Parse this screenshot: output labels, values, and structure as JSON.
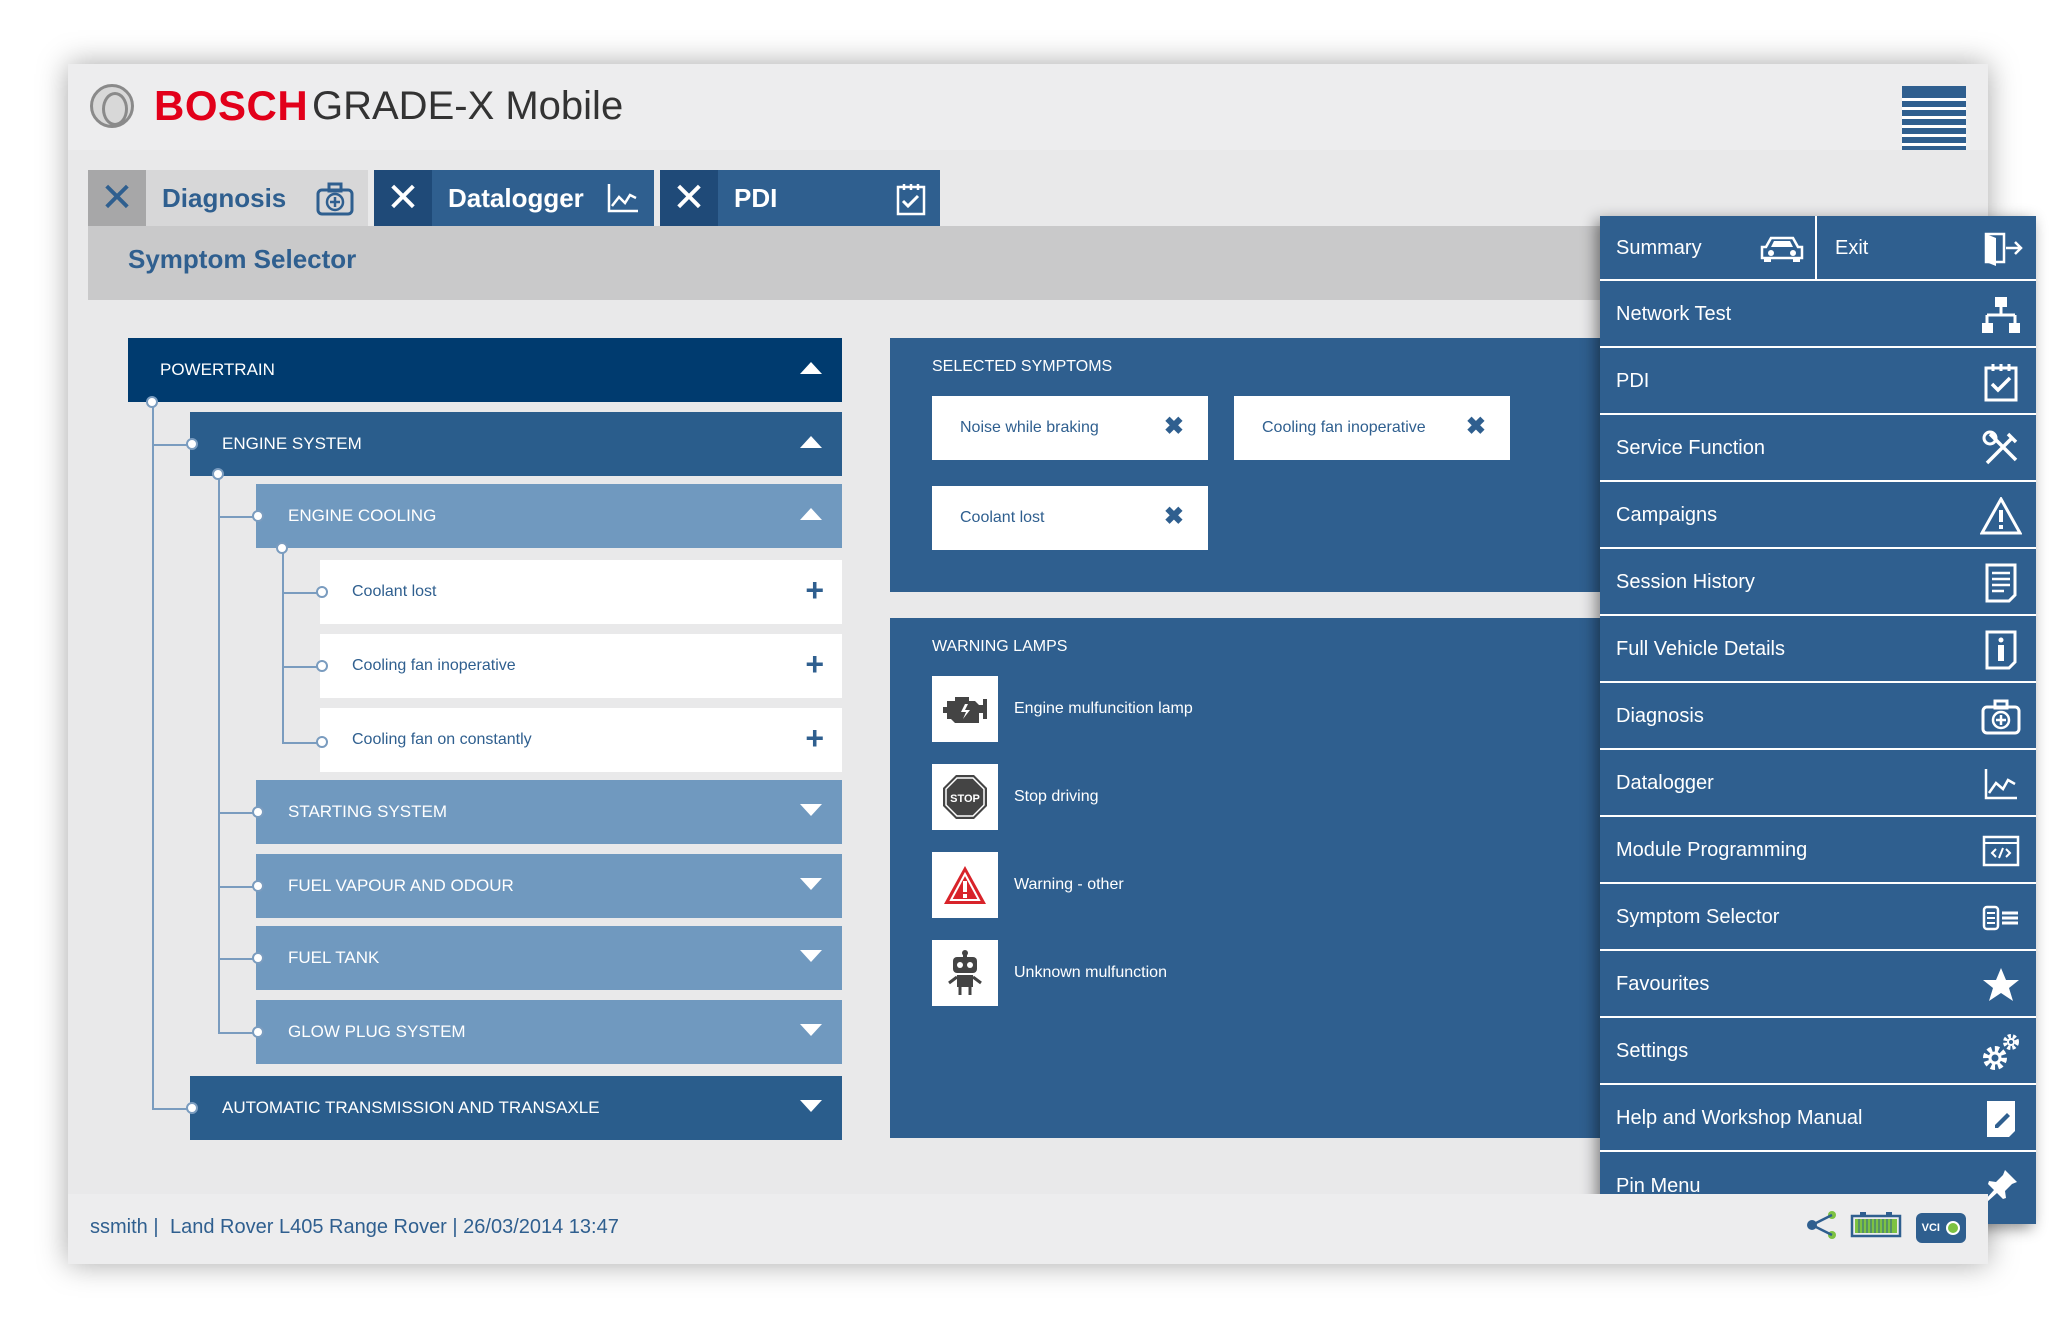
{
  "header": {
    "brand": "BOSCH",
    "app_title": "GRADE-X Mobile"
  },
  "tabs": [
    {
      "label": "Diagnosis",
      "icon": "medical-kit-icon"
    },
    {
      "label": "Datalogger",
      "icon": "line-chart-icon"
    },
    {
      "label": "PDI",
      "icon": "clipboard-check-icon"
    }
  ],
  "page": {
    "title": "Symptom Selector"
  },
  "tree": {
    "powertrain": "POWERTRAIN",
    "engine_system": "ENGINE SYSTEM",
    "engine_cooling": "ENGINE COOLING",
    "leaves": [
      "Coolant lost",
      "Cooling fan inoperative",
      "Cooling fan on constantly"
    ],
    "starting_system": "STARTING SYSTEM",
    "fuel_vapour": "FUEL VAPOUR AND ODOUR",
    "fuel_tank": "FUEL TANK",
    "glow_plug": "GLOW PLUG SYSTEM",
    "auto_trans": "AUTOMATIC TRANSMISSION AND TRANSAXLE"
  },
  "selected": {
    "heading": "SELECTED SYMPTOMS",
    "items": [
      "Noise while braking",
      "Cooling fan inoperative",
      "Coolant lost"
    ]
  },
  "lamps": {
    "heading": "WARNING LAMPS",
    "items": [
      {
        "label": "Engine mulfuncition lamp",
        "icon": "engine-icon"
      },
      {
        "label": "Stop driving",
        "icon": "stop-sign-icon"
      },
      {
        "label": "Warning - other",
        "icon": "warning-triangle-icon"
      },
      {
        "label": "Unknown mulfunction",
        "icon": "robot-icon"
      }
    ]
  },
  "menu": {
    "summary": "Summary",
    "exit": "Exit",
    "items": [
      {
        "label": "Network Test",
        "icon": "network-icon"
      },
      {
        "label": "PDI",
        "icon": "clipboard-check-icon"
      },
      {
        "label": "Service Function",
        "icon": "tools-icon"
      },
      {
        "label": "Campaigns",
        "icon": "warning-icon"
      },
      {
        "label": "Session History",
        "icon": "document-list-icon"
      },
      {
        "label": "Full Vehicle Details",
        "icon": "info-icon"
      },
      {
        "label": "Diagnosis",
        "icon": "medical-kit-icon"
      },
      {
        "label": "Datalogger",
        "icon": "line-chart-icon"
      },
      {
        "label": "Module Programming",
        "icon": "code-window-icon"
      },
      {
        "label": "Symptom Selector",
        "icon": "list-select-icon"
      },
      {
        "label": "Favourites",
        "icon": "star-icon"
      },
      {
        "label": "Settings",
        "icon": "gears-icon"
      },
      {
        "label": "Help and Workshop Manual",
        "icon": "manual-icon"
      },
      {
        "label": "Pin Menu",
        "icon": "pin-icon"
      }
    ]
  },
  "status": {
    "user": "ssmith |",
    "vehicle": "Land Rover L405 Range Rover | 26/03/2014 13:47",
    "vci_label": "VCI"
  },
  "colors": {
    "primary": "#2f5f8f",
    "dark": "#003b6f",
    "light_blue": "#7099bf",
    "bosch_red": "#e2001a"
  }
}
